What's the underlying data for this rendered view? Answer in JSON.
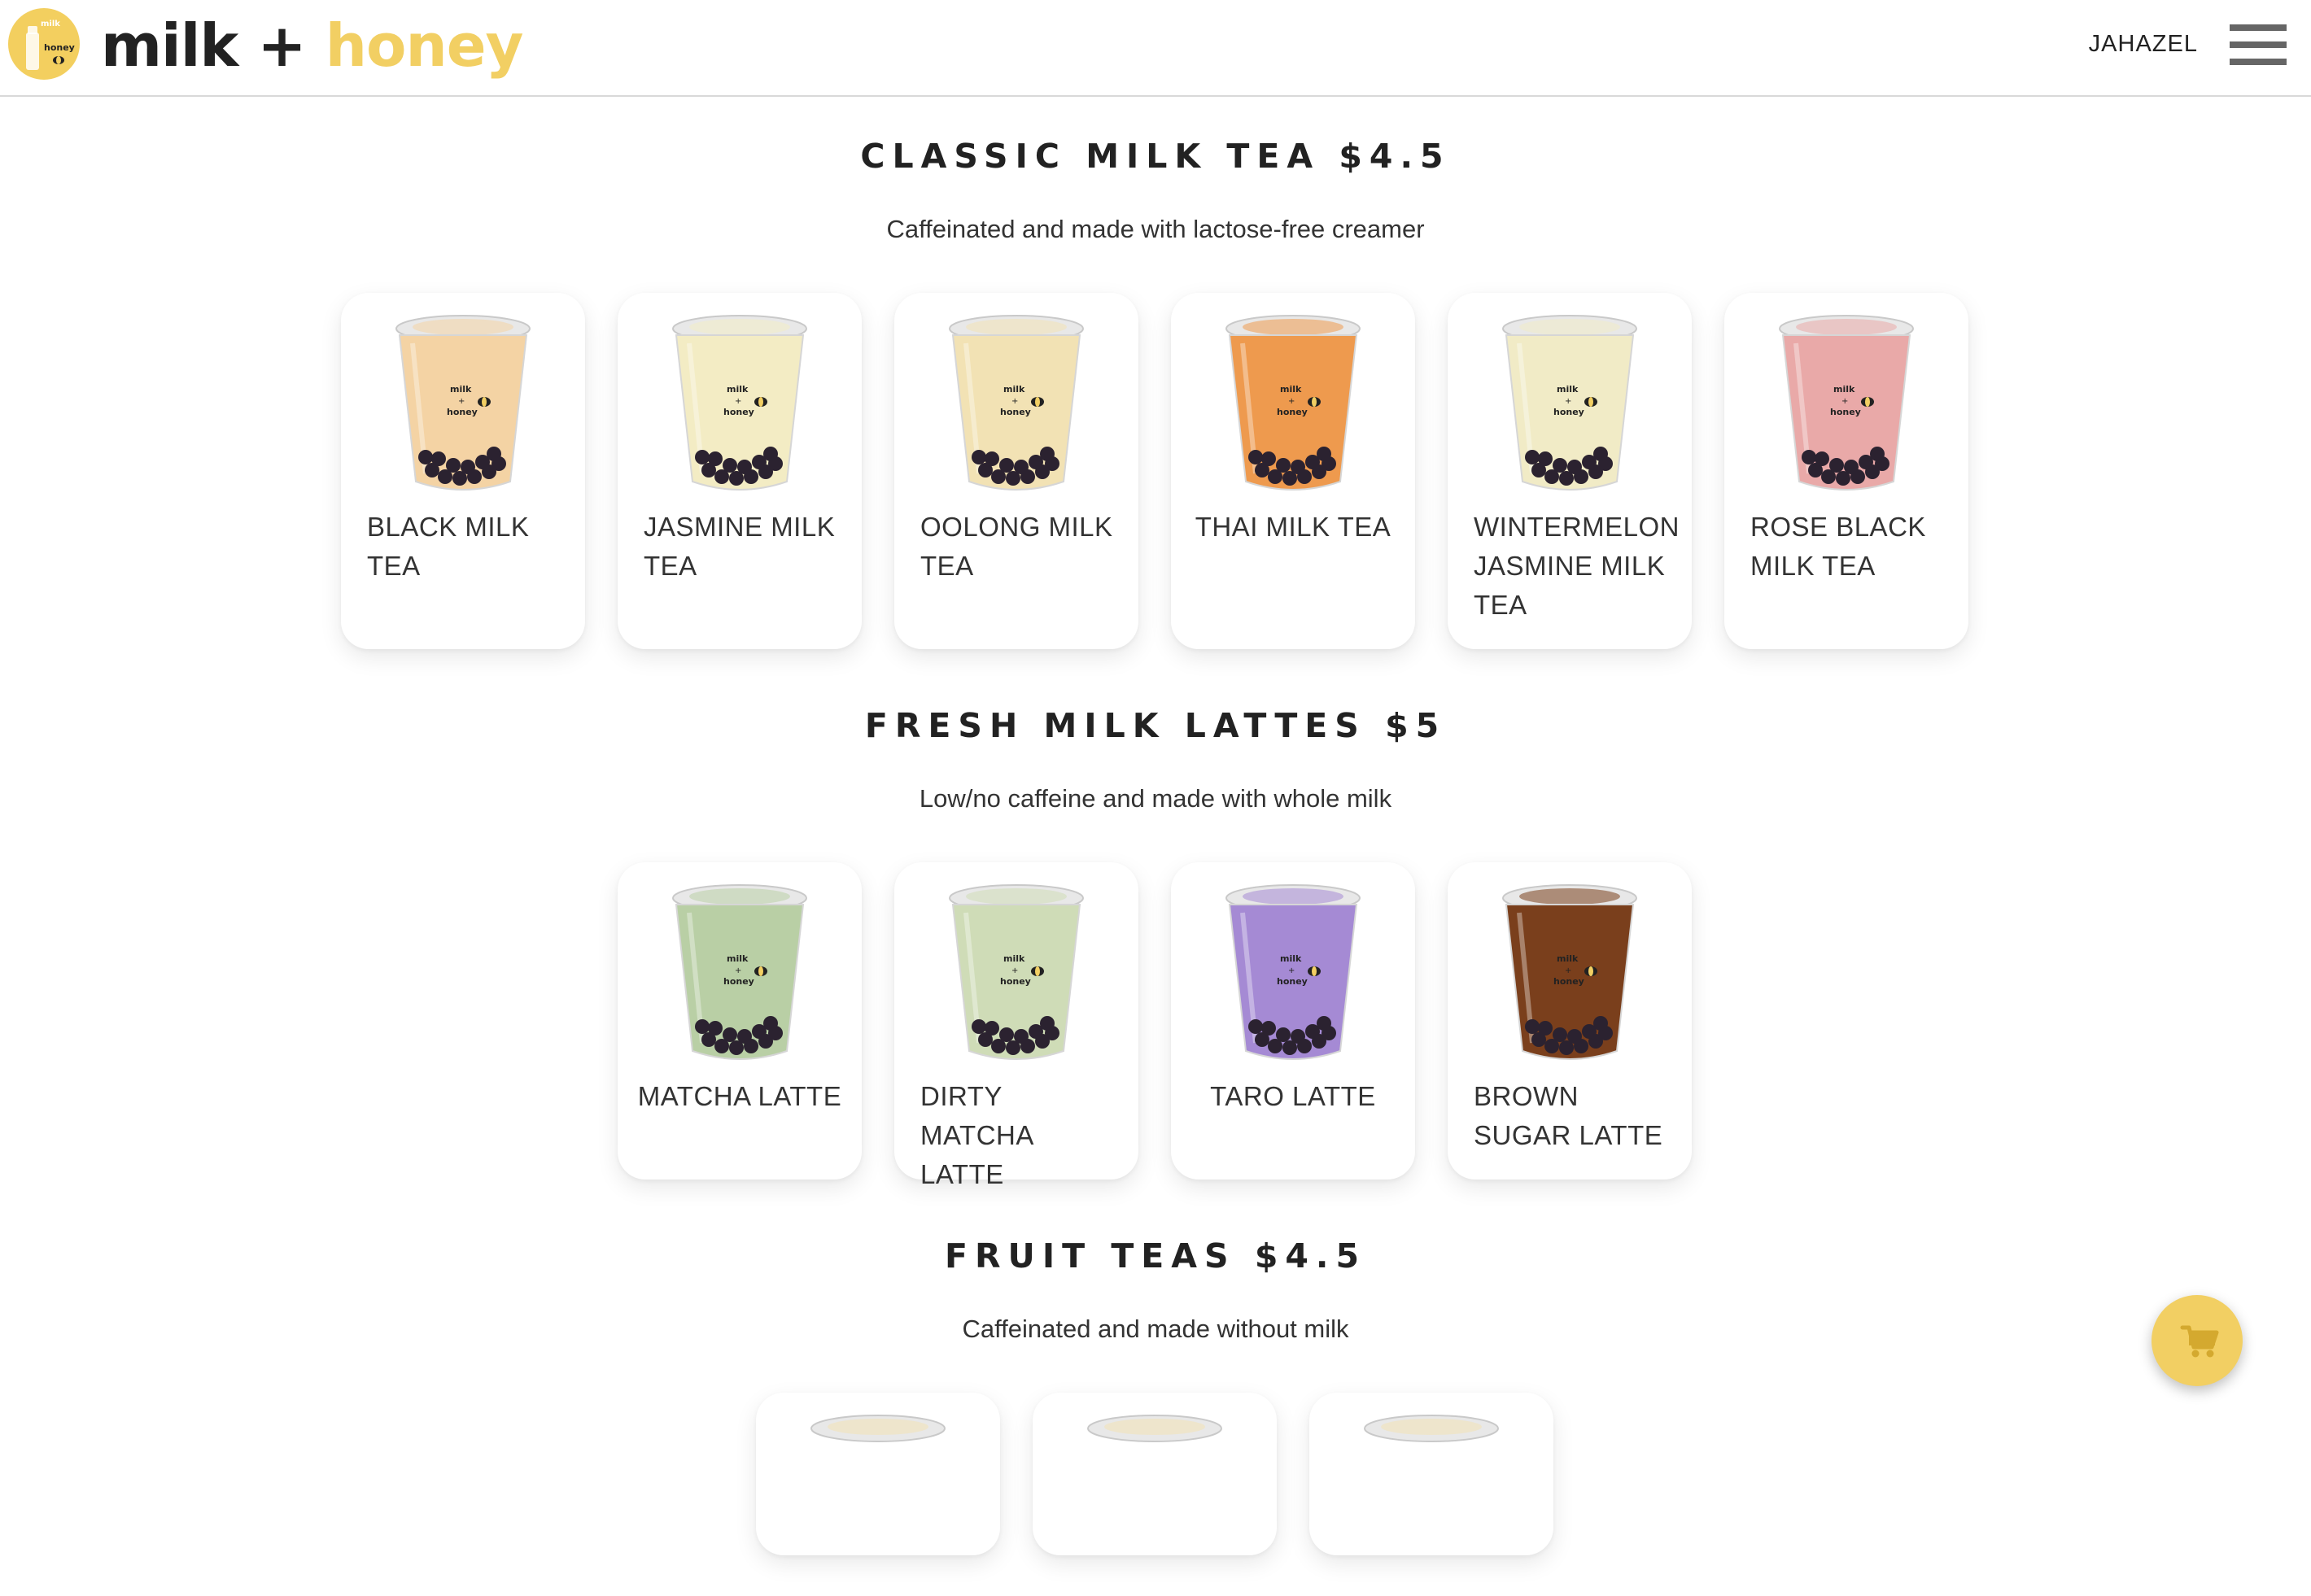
{
  "header": {
    "brand_part1": "milk",
    "brand_plus": " + ",
    "brand_part2": "honey",
    "logo_text_top": "milk",
    "logo_text_bottom": "honey",
    "user_name": "JAHAZEL",
    "menu_icon": "hamburger-menu-icon"
  },
  "cup_label": {
    "line1": "milk",
    "line2": "+",
    "line3": "honey"
  },
  "colors": {
    "brand_yellow": "#f2cf63",
    "text_dark": "#222222",
    "cup_classic": "#f4d3a4",
    "cup_jasmine": "#f3ecc4",
    "cup_oolong": "#f2e2b4",
    "cup_thai": "#ee9a4e",
    "cup_wintermelon": "#f1ebc6",
    "cup_rose": "#e9a9a8",
    "cup_matcha": "#b9cfa5",
    "cup_dirty_matcha": "#cfdcb7",
    "cup_taro": "#a58ad4",
    "cup_brown_sugar": "#7a3f1c"
  },
  "sections": [
    {
      "title": "CLASSIC MILK TEA $4.5",
      "subtitle": "Caffeinated and made with lactose-free creamer",
      "items": [
        {
          "name": "BLACK MILK TEA"
        },
        {
          "name": "JASMINE MILK TEA"
        },
        {
          "name": "OOLONG MILK TEA"
        },
        {
          "name": "THAI MILK TEA"
        },
        {
          "name": "WINTERMELON JASMINE MILK TEA"
        },
        {
          "name": "ROSE BLACK MILK TEA"
        }
      ]
    },
    {
      "title": "FRESH MILK LATTES $5",
      "subtitle": "Low/no caffeine and made with whole milk",
      "items": [
        {
          "name": "MATCHA LATTE"
        },
        {
          "name": "DIRTY MATCHA LATTE"
        },
        {
          "name": "TARO LATTE"
        },
        {
          "name": "BROWN SUGAR LATTE"
        }
      ]
    },
    {
      "title": "FRUIT TEAS $4.5",
      "subtitle": "Caffeinated and made without milk",
      "items": [
        {},
        {},
        {}
      ]
    }
  ],
  "cart": {
    "icon": "shopping-cart-icon"
  }
}
